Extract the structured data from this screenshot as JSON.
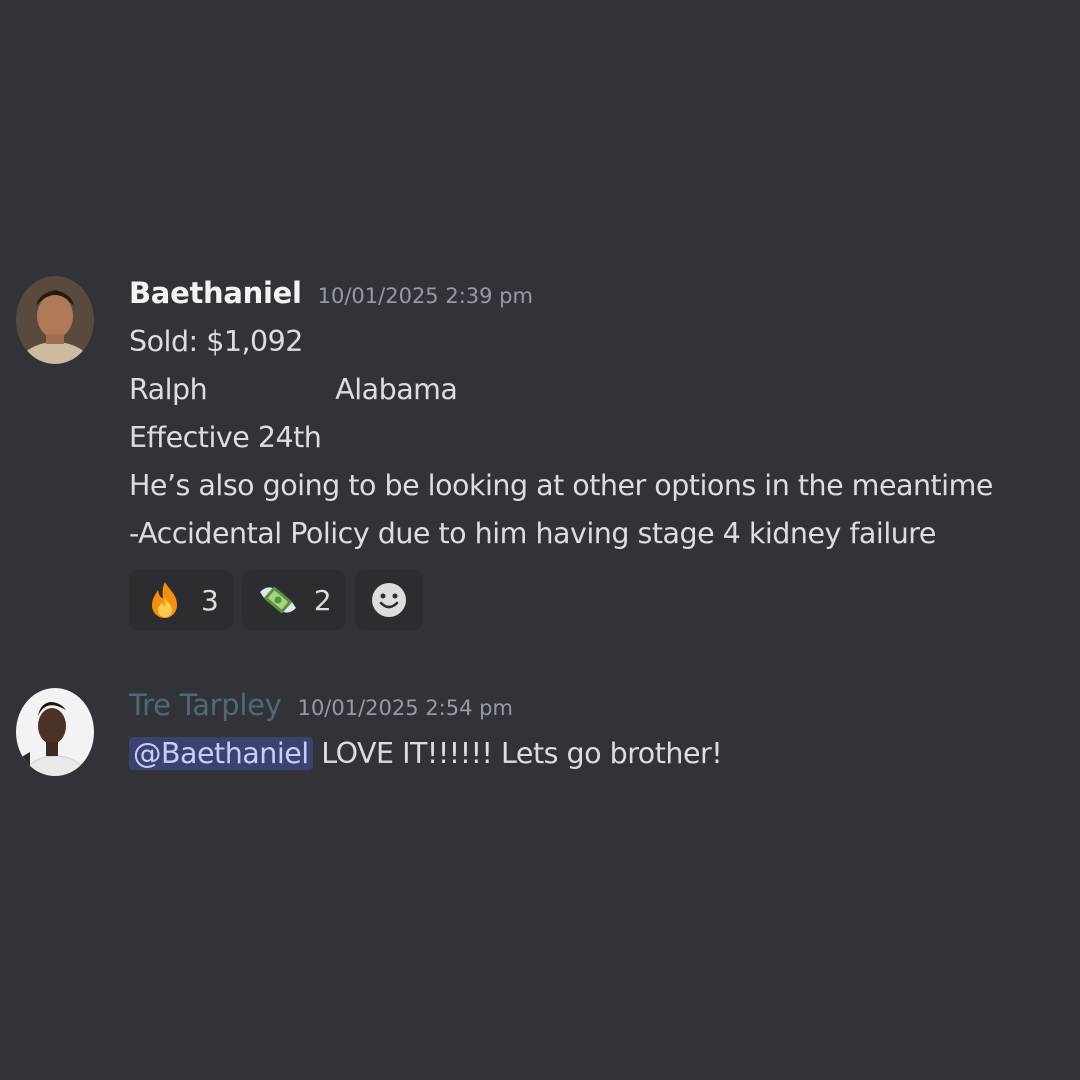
{
  "messages": [
    {
      "author": "Baethaniel",
      "timestamp": "10/01/2025 2:39 pm",
      "lines": {
        "sold": "Sold: $1,092",
        "name": "Ralph",
        "state": "Alabama",
        "effective": "Effective 24th",
        "note": "He’s also going to be looking at other options in the meantime",
        "policy": "-Accidental Policy due to him having stage 4 kidney failure"
      },
      "reactions": [
        {
          "emoji": "fire-emoji",
          "count": "3"
        },
        {
          "emoji": "money-with-wings-emoji",
          "count": "2"
        }
      ],
      "add_reaction_icon": "smiley-icon"
    },
    {
      "author": "Tre Tarpley",
      "timestamp": "10/01/2025 2:54 pm",
      "mention": "@Baethaniel",
      "text": " LOVE IT!!!!!! Lets go brother!"
    }
  ],
  "colors": {
    "background": "#313338",
    "mention_bg": "#3c4270",
    "reaction_bg": "#2b2d31"
  }
}
